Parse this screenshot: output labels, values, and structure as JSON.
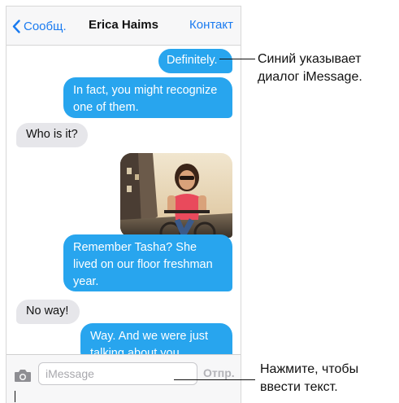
{
  "navbar": {
    "back_label": "Сообщ.",
    "title": "Erica Haims",
    "contact_label": "Контакт"
  },
  "messages": [
    {
      "side": "out",
      "text": "Definitely."
    },
    {
      "side": "out",
      "text": "In fact, you might recognize one of them."
    },
    {
      "side": "in",
      "text": "Who is it?"
    },
    {
      "side": "out",
      "type": "photo"
    },
    {
      "side": "out",
      "text": "Remember Tasha? She lived on our floor freshman year."
    },
    {
      "side": "in",
      "text": "No way!"
    },
    {
      "side": "out",
      "text": "Way. And we were just talking about you."
    }
  ],
  "input_bar": {
    "placeholder": "iMessage",
    "send_label": "Отпр."
  },
  "callouts": {
    "blue": "Синий указывает диалог iMessage.",
    "tap_to_type": "Нажмите, чтобы ввести текст."
  },
  "colors": {
    "imessage_blue": "#28a5ee",
    "link_blue": "#1a7bf0",
    "incoming_gray": "#e6e6ea"
  }
}
